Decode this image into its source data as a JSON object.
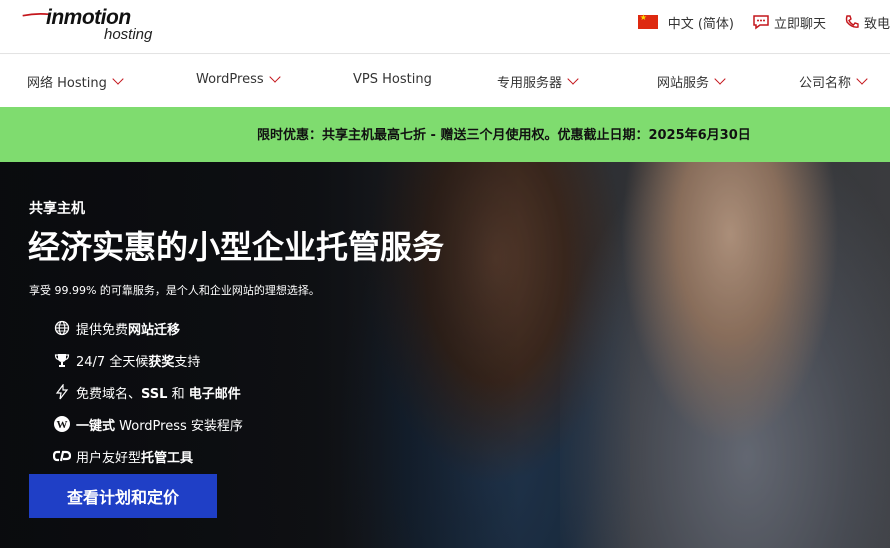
{
  "header": {
    "logo_brand": "inmotion",
    "logo_sub": "hosting",
    "language": "中文 (简体)",
    "chat": "立即聊天",
    "phone": "致电"
  },
  "nav": {
    "items": [
      {
        "label": "网络 Hosting"
      },
      {
        "label": "WordPress"
      },
      {
        "label": "VPS Hosting"
      },
      {
        "label": "专用服务器"
      },
      {
        "label": "网站服务"
      },
      {
        "label": "公司名称"
      }
    ]
  },
  "promo": {
    "text": "限时优惠：共享主机最高七折 - 赠送三个月使用权。优惠截止日期：2025年6月30日"
  },
  "hero": {
    "eyebrow": "共享主机",
    "headline": "经济实惠的小型企业托管服务",
    "tagline": "享受 99.99% 的可靠服务，是个人和企业网站的理想选择。",
    "features": [
      {
        "icon": "globe-icon",
        "pre": "提供免费",
        "bold": "网站迁移",
        "post": ""
      },
      {
        "icon": "trophy-icon",
        "pre": "24/7 全天候",
        "bold": "获奖",
        "post": "支持"
      },
      {
        "icon": "lightning-icon",
        "pre": "免费域名、",
        "bold": "SSL",
        "post": " 和 ",
        "bold2": "电子邮件"
      },
      {
        "icon": "wordpress-icon",
        "pre": "",
        "bold": "一键式",
        "post": " WordPress 安装程序"
      },
      {
        "icon": "cpanel-icon",
        "pre": "用户友好型",
        "bold": "托管工具",
        "post": ""
      }
    ],
    "cta": "查看计划和定价"
  },
  "colors": {
    "accent_red": "#c4161c",
    "promo_green": "#7fdc6f",
    "cta_blue": "#1f3fc6"
  }
}
